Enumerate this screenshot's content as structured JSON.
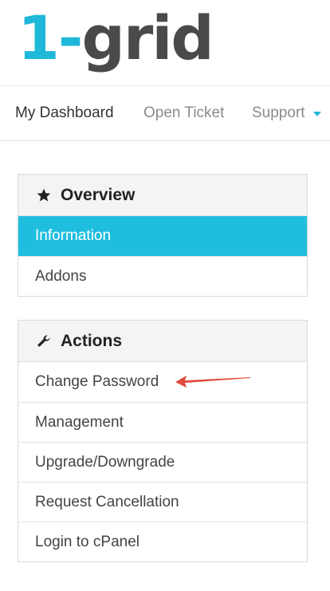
{
  "logo": {
    "part1": "1-",
    "part2": "grid"
  },
  "nav": {
    "dashboard": "My Dashboard",
    "open_ticket": "Open Ticket",
    "support": "Support"
  },
  "overview": {
    "title": "Overview",
    "items": [
      "Information",
      "Addons"
    ],
    "active_index": 0
  },
  "actions": {
    "title": "Actions",
    "items": [
      "Change Password",
      "Management",
      "Upgrade/Downgrade",
      "Request Cancellation",
      "Login to cPanel"
    ]
  },
  "colors": {
    "accent": "#1fbedf",
    "logo_dark": "#4a4a4a",
    "annotation": "#e04a3a"
  },
  "icons": {
    "overview": "star-icon",
    "actions": "wrench-icon",
    "support_dropdown": "caret-down-icon",
    "annotation": "arrow-annotation"
  }
}
